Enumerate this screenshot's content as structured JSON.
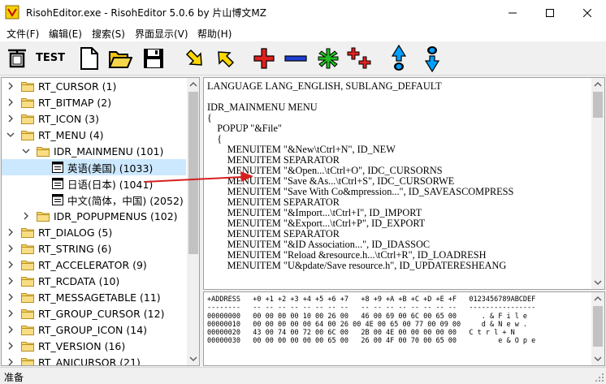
{
  "window": {
    "title": "RisohEditor.exe - RisohEditor 5.0.6 by 片山博文MZ"
  },
  "menu": [
    "文件(F)",
    "编辑(E)",
    "搜索(S)",
    "界面显示(V)",
    "帮助(H)"
  ],
  "toolbar": {
    "test_label": "TEST"
  },
  "tree": [
    {
      "label": "RT_CURSOR (1)"
    },
    {
      "label": "RT_BITMAP (2)"
    },
    {
      "label": "RT_ICON (3)"
    },
    {
      "label": "RT_MENU (4)"
    },
    {
      "label": "IDR_MAINMENU (101)"
    },
    {
      "label": "英语(美国) (1033)"
    },
    {
      "label": "日语(日本) (1041)"
    },
    {
      "label": "中文(简体，中国) (2052)"
    },
    {
      "label": "IDR_POPUPMENUS (102)"
    },
    {
      "label": "RT_DIALOG (5)"
    },
    {
      "label": "RT_STRING (6)"
    },
    {
      "label": "RT_ACCELERATOR (9)"
    },
    {
      "label": "RT_RCDATA (10)"
    },
    {
      "label": "RT_MESSAGETABLE (11)"
    },
    {
      "label": "RT_GROUP_CURSOR (12)"
    },
    {
      "label": "RT_GROUP_ICON (14)"
    },
    {
      "label": "RT_VERSION (16)"
    },
    {
      "label": "RT_ANICURSOR (21)"
    }
  ],
  "code": [
    "LANGUAGE LANG_ENGLISH, SUBLANG_DEFAULT",
    "",
    "IDR_MAINMENU MENU",
    "{",
    "    POPUP \"&File\"",
    "    {",
    "        MENUITEM \"&New\\tCtrl+N\", ID_NEW",
    "        MENUITEM SEPARATOR",
    "        MENUITEM \"&Open...\\tCtrl+O\", IDC_CURSORNS",
    "        MENUITEM \"Save &As...\\tCtrl+S\", IDC_CURSORWE",
    "        MENUITEM \"Save With Co&mpression...\", ID_SAVEASCOMPRESS",
    "        MENUITEM SEPARATOR",
    "        MENUITEM \"&Import...\\tCtrl+I\", ID_IMPORT",
    "        MENUITEM \"&Export...\\tCtrl+P\", ID_EXPORT",
    "        MENUITEM SEPARATOR",
    "        MENUITEM \"&ID Association...\", ID_IDASSOC",
    "        MENUITEM \"Reload &resource.h...\\tCtrl+R\", ID_LOADRESH",
    "        MENUITEM \"U&pdate/Save resource.h\", ID_UPDATERESHEANG"
  ],
  "hex": [
    "+ADDRESS   +0 +1 +2 +3 +4 +5 +6 +7   +8 +9 +A +B +C +D +E +F   0123456789ABCDEF",
    "--------   -- -- -- -- -- -- -- --   -- -- -- -- -- -- -- --   ----------------",
    "00000000   00 00 00 00 10 00 26 00   46 00 69 00 6C 00 65 00      . & F i l e",
    "00000010   00 00 00 00 00 64 00 26 00 4E 00 65 00 77 00 09 00     d & N e w .",
    "00000020   43 00 74 00 72 00 6C 00   2B 00 4E 00 00 00 00 00   C t r l + N",
    "00000030   00 00 00 00 00 00 65 00   26 00 4F 00 70 00 65 00          e & O p e"
  ],
  "status": "准备"
}
